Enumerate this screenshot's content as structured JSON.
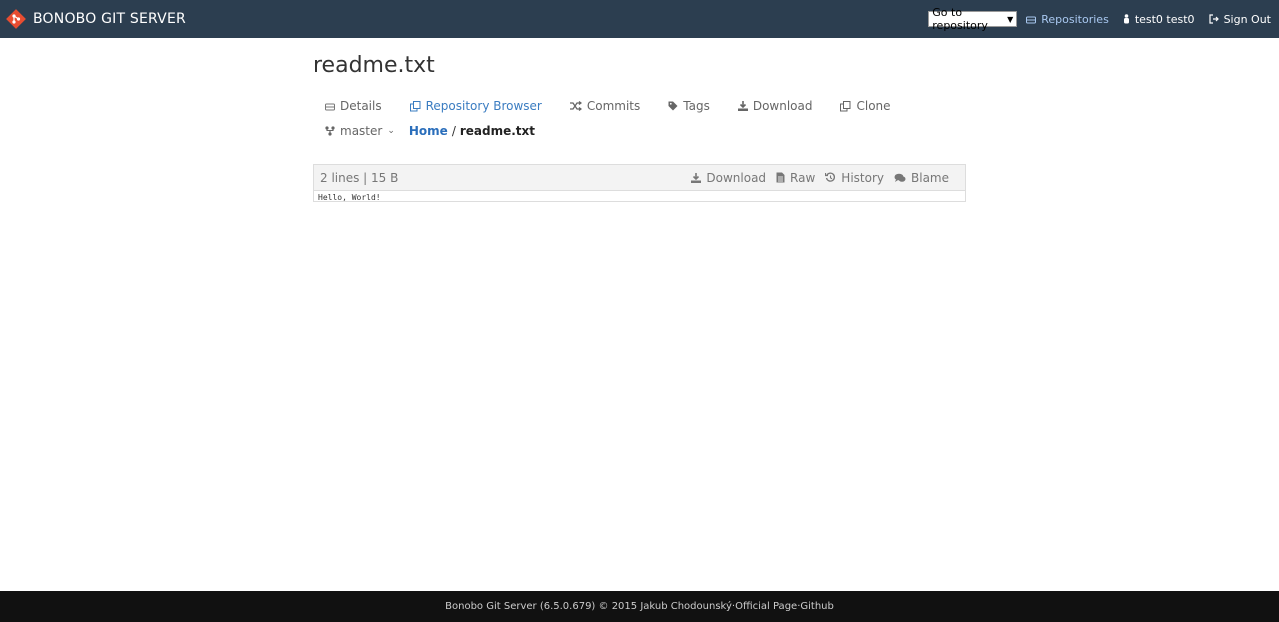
{
  "header": {
    "brand": "BONOBO GIT SERVER",
    "repo_select": "Go to repository",
    "repositories": "Repositories",
    "user": "test0 test0",
    "sign_out": "Sign Out",
    "bg_color": "#2c3e50"
  },
  "page": {
    "title": "readme.txt"
  },
  "tabs": [
    {
      "label": "Details",
      "icon": "drive-icon"
    },
    {
      "label": "Repository Browser",
      "icon": "copy-icon",
      "active": true
    },
    {
      "label": "Commits",
      "icon": "shuffle-icon"
    },
    {
      "label": "Tags",
      "icon": "tag-icon"
    },
    {
      "label": "Download",
      "icon": "download-icon"
    },
    {
      "label": "Clone",
      "icon": "copy-icon"
    }
  ],
  "branch": {
    "name": "master"
  },
  "breadcrumb": {
    "home": "Home",
    "separator": "/",
    "file": "readme.txt"
  },
  "file": {
    "info": "2 lines | 15 B",
    "actions": {
      "download": "Download",
      "raw": "Raw",
      "history": "History",
      "blame": "Blame"
    },
    "content": "Hello, World!"
  },
  "footer": {
    "text": "Bonobo Git Server (6.5.0.679) © 2015 Jakub Chodounský",
    "sep1": " · ",
    "official_page": "Official Page",
    "sep2": " · ",
    "github": "Github"
  }
}
